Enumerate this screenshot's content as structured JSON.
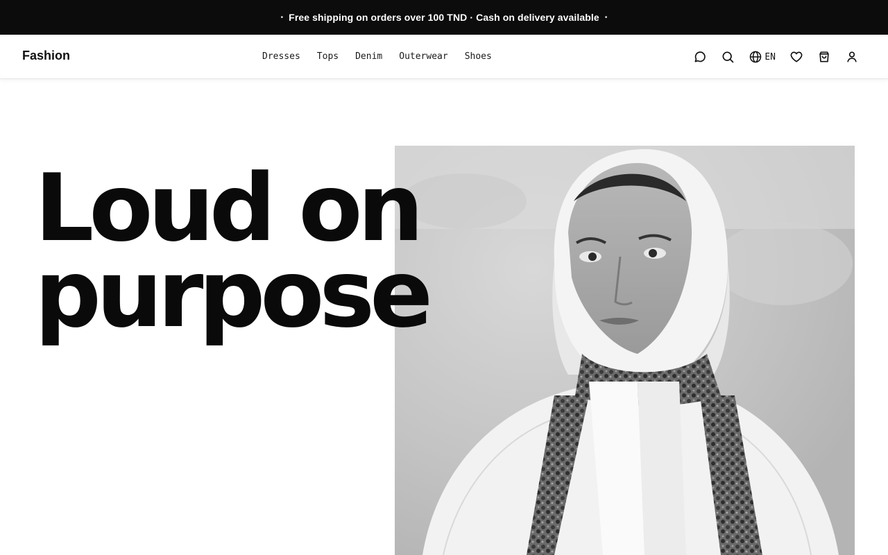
{
  "announcement": {
    "text": "Free shipping on orders over 100 TND · Cash on delivery available",
    "bullet": "•"
  },
  "header": {
    "logo": "Fashion",
    "nav": [
      {
        "label": "Dresses"
      },
      {
        "label": "Tops"
      },
      {
        "label": "Denim"
      },
      {
        "label": "Outerwear"
      },
      {
        "label": "Shoes"
      }
    ],
    "actions": {
      "chat_icon": "chat-bubble-icon",
      "search_icon": "search-icon",
      "language_icon": "globe-icon",
      "language": "EN",
      "wishlist_icon": "heart-icon",
      "cart_icon": "shopping-bag-icon",
      "account_icon": "user-icon"
    }
  },
  "hero": {
    "title_line1": "Loud on",
    "title_line2": "purpose"
  },
  "colors": {
    "announcement_bg": "#0c0c0c",
    "text": "#0a0a0a",
    "background": "#ffffff"
  }
}
